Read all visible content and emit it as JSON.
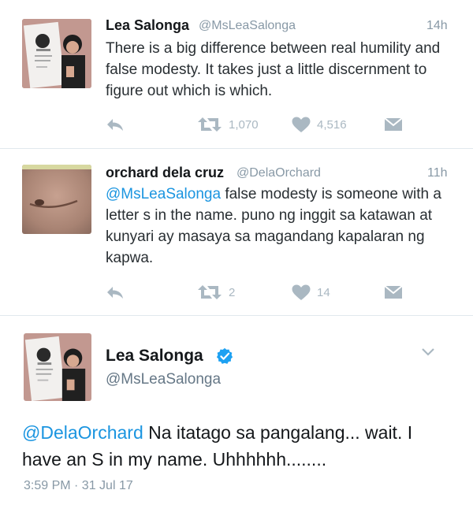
{
  "tweets": [
    {
      "name": "Lea Salonga",
      "handle": "@MsLeaSalonga",
      "time": "14h",
      "text": "There is a big difference between real humility and false modesty. It takes just a little discernment to figure out which is which.",
      "retweets": "1,070",
      "likes": "4,516"
    },
    {
      "name": "orchard dela cruz",
      "handle": "@DelaOrchard",
      "time": "11h",
      "mention": "@MsLeaSalonga",
      "text": " false modesty is someone with a letter s in the name. puno ng inggit sa katawan at kunyari ay masaya sa magandang kapalaran ng kapwa.",
      "retweets": "2",
      "likes": "14"
    }
  ],
  "main_tweet": {
    "name": "Lea Salonga",
    "handle": "@MsLeaSalonga",
    "mention": "@DelaOrchard",
    "text": " Na itatago sa pangalang... wait. I have an S in my name. Uhhhhhh........",
    "timestamp": "3:59 PM · 31 Jul 17"
  },
  "colors": {
    "link": "#1b95e0",
    "verified": "#1da1f2",
    "icon": "#aab8c2"
  },
  "icons": [
    "reply-icon",
    "retweet-icon",
    "heart-icon",
    "direct-message-icon",
    "verified-icon",
    "chevron-down-icon"
  ]
}
